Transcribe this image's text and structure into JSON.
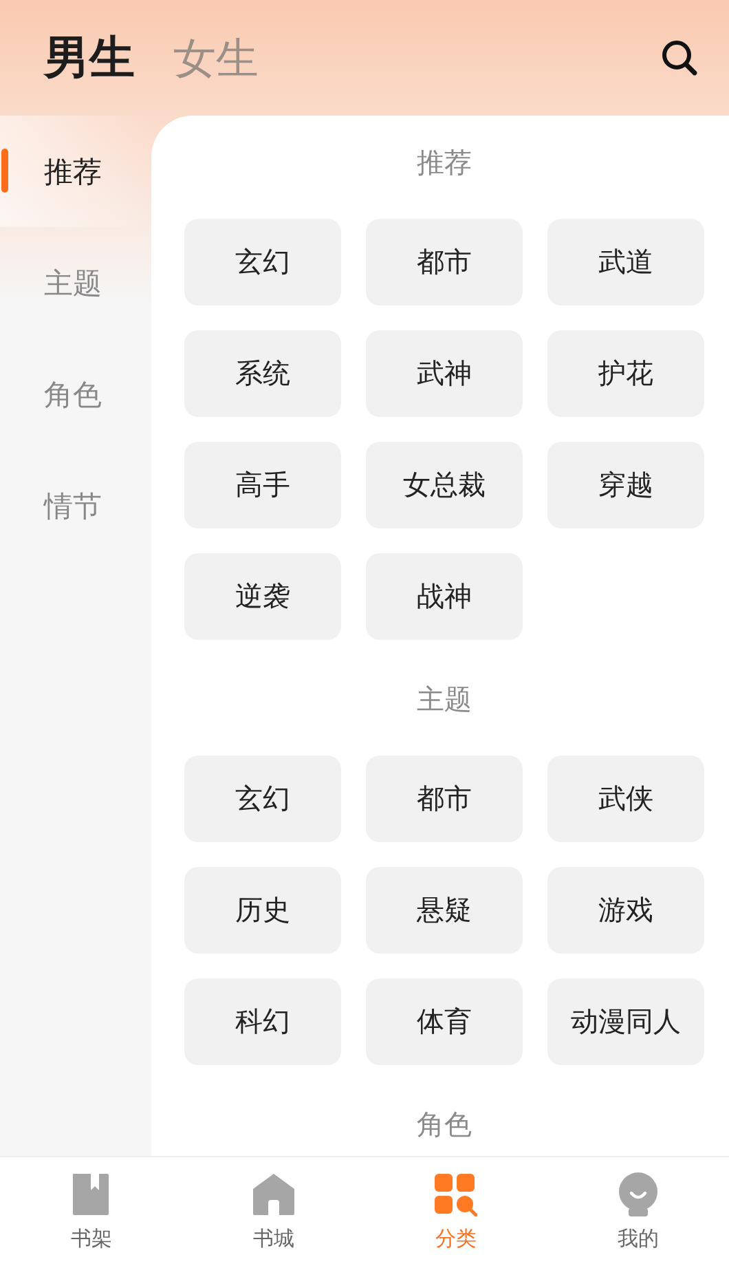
{
  "gender_tabs": [
    {
      "label": "男生",
      "selected": true
    },
    {
      "label": "女生",
      "selected": false
    }
  ],
  "sidebar": {
    "items": [
      {
        "label": "推荐",
        "selected": true
      },
      {
        "label": "主题",
        "selected": false
      },
      {
        "label": "角色",
        "selected": false
      },
      {
        "label": "情节",
        "selected": false
      }
    ]
  },
  "sections": [
    {
      "title": "推荐",
      "tags": [
        "玄幻",
        "都市",
        "武道",
        "系统",
        "武神",
        "护花",
        "高手",
        "女总裁",
        "穿越",
        "逆袭",
        "战神"
      ]
    },
    {
      "title": "主题",
      "tags": [
        "玄幻",
        "都市",
        "武侠",
        "历史",
        "悬疑",
        "游戏",
        "科幻",
        "体育",
        "动漫同人"
      ]
    },
    {
      "title": "角色"
    }
  ],
  "bottom_nav": [
    {
      "label": "书架",
      "kind": "bookshelf",
      "selected": false
    },
    {
      "label": "书城",
      "kind": "store",
      "selected": false
    },
    {
      "label": "分类",
      "kind": "category",
      "selected": true
    },
    {
      "label": "我的",
      "kind": "profile",
      "selected": false
    }
  ]
}
